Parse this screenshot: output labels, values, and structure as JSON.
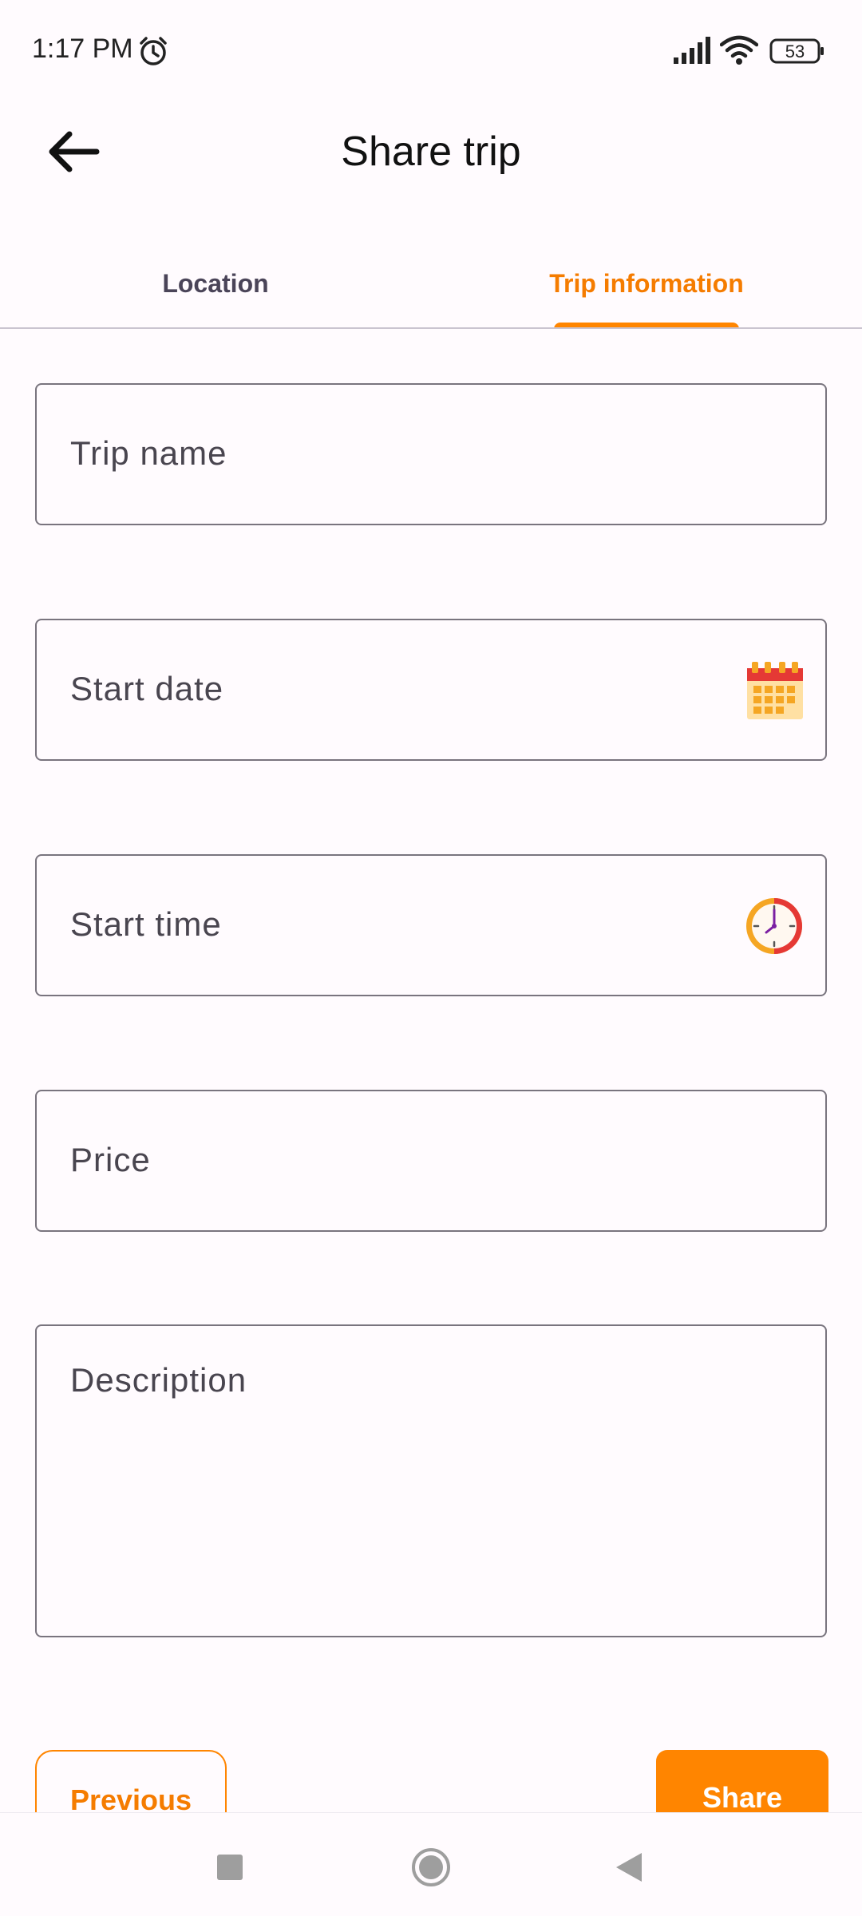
{
  "status_bar": {
    "time": "1:17 PM",
    "battery": "53",
    "icons": [
      "alarm-icon",
      "signal-icon",
      "wifi-icon",
      "battery-icon"
    ]
  },
  "app_bar": {
    "title": "Share trip",
    "back_icon": "arrow-back-icon"
  },
  "tabs": [
    {
      "label": "Location",
      "selected": false
    },
    {
      "label": "Trip information",
      "selected": true
    }
  ],
  "form": {
    "trip_name_label": "Trip name",
    "start_date_label": "Start date",
    "start_time_label": "Start time",
    "price_label": "Price",
    "description_label": "Description",
    "start_date_icon": "calendar-icon",
    "start_time_icon": "clock-icon"
  },
  "buttons": {
    "previous": "Previous",
    "share": "Share"
  },
  "nav_bar": {
    "icons": [
      "recents-icon",
      "home-icon",
      "back-icon"
    ]
  },
  "colors": {
    "accent": "#ff8500",
    "accent_text": "#f57c00",
    "background": "#fffbfe",
    "outline": "#79747e"
  }
}
